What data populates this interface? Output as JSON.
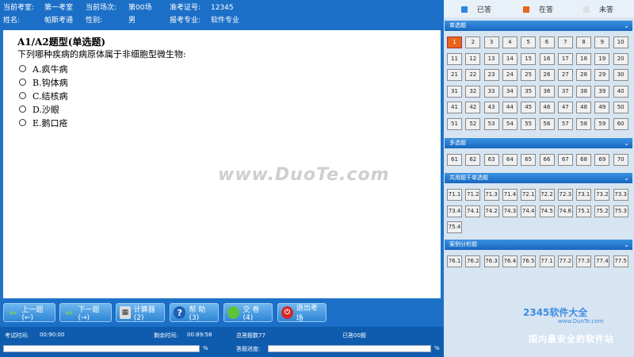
{
  "header": {
    "room_label": "当前考室:",
    "room_value": "第一考室",
    "session_label": "当前场次:",
    "session_value": "第00场",
    "ticket_label": "准考证号:",
    "ticket_value": "12345",
    "name_label": "姓名:",
    "name_value": "帕斯考通",
    "gender_label": "性别:",
    "gender_value": "男",
    "major_label": "报考专业:",
    "major_value": "软件专业"
  },
  "question": {
    "type": "A1/A2题型(单选题)",
    "text": "下列哪种疾病的病原体属于非细胞型微生物:",
    "options": [
      "A.疯牛病",
      "B.钩体病",
      "C.结核病",
      "D.沙眼",
      "E.鹅口疮"
    ]
  },
  "watermark": "www.DuoTe.com",
  "toolbar": {
    "prev": "上一题(←)",
    "next": "下一题(→)",
    "calc": "计算器(2)",
    "help": "帮  助(3)",
    "submit": "交  卷(4)",
    "exit": "退出考场"
  },
  "status": {
    "exam_time_label": "考试时间:",
    "exam_time": "00:90:00",
    "remaining_label": "剩余时间:",
    "remaining": "00:89:58",
    "total_label": "总答题数77",
    "answered": "已答00题",
    "progress_label": "答题进度:",
    "pct": "%",
    "pct2": "%",
    "progress": 0
  },
  "legend": {
    "answered": "已答",
    "current": "在答",
    "unanswered": "未答",
    "colors": {
      "answered": "#2a8ae0",
      "current": "#e8641c",
      "unanswered": "#e0e0e0"
    }
  },
  "sections": [
    {
      "title": "单选题",
      "items": [
        "1",
        "2",
        "3",
        "4",
        "5",
        "6",
        "7",
        "8",
        "9",
        "10",
        "11",
        "12",
        "13",
        "14",
        "15",
        "16",
        "17",
        "18",
        "19",
        "20",
        "21",
        "22",
        "23",
        "24",
        "25",
        "26",
        "27",
        "28",
        "29",
        "30",
        "31",
        "32",
        "33",
        "34",
        "35",
        "36",
        "37",
        "38",
        "39",
        "40",
        "41",
        "42",
        "43",
        "44",
        "45",
        "46",
        "47",
        "48",
        "49",
        "50",
        "51",
        "52",
        "53",
        "54",
        "55",
        "56",
        "57",
        "58",
        "59",
        "60"
      ]
    },
    {
      "title": "多选题",
      "items": [
        "61",
        "62",
        "63",
        "64",
        "65",
        "66",
        "67",
        "68",
        "69",
        "70"
      ]
    },
    {
      "title": "共用题干单选题",
      "items": [
        "71.1",
        "71.2",
        "71.3",
        "71.4",
        "72.1",
        "72.2",
        "72.3",
        "73.1",
        "73.2",
        "73.3",
        "73.4",
        "74.1",
        "74.2",
        "74.3",
        "74.4",
        "74.5",
        "74.6",
        "75.1",
        "75.2",
        "75.3",
        "75.4"
      ]
    },
    {
      "title": "案例分析题",
      "items": [
        "76.1",
        "76.2",
        "76.3",
        "76.4",
        "76.5",
        "77.1",
        "77.2",
        "77.3",
        "77.4",
        "77.5"
      ]
    }
  ],
  "brand": {
    "name": "2345软件大全",
    "url": "www.DuoTe.com",
    "slogan": "国内最安全的软件站"
  }
}
